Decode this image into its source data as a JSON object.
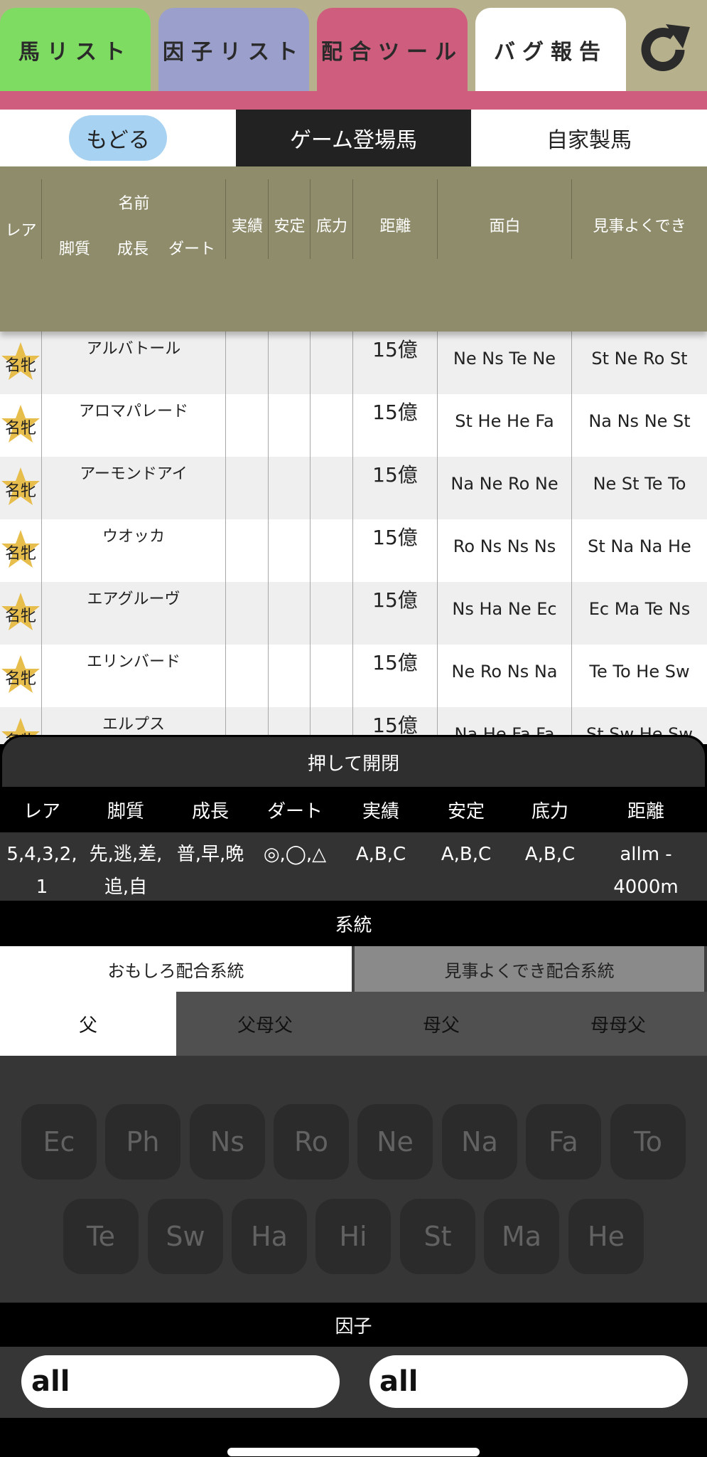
{
  "top_tabs": [
    {
      "label": "馬リスト"
    },
    {
      "label": "因子リスト"
    },
    {
      "label": "配合ツール"
    },
    {
      "label": "バグ報告"
    }
  ],
  "sub_tabs": {
    "back": "もどる",
    "game": "ゲーム登場馬",
    "home": "自家製馬"
  },
  "header": {
    "rarity": "レア",
    "name": "名前",
    "style": "脚質",
    "growth": "成長",
    "dirt": "ダート",
    "record": "実績",
    "stable": "安定",
    "power": "底力",
    "distance": "距離",
    "fun": "面白",
    "good": "見事よくでき"
  },
  "rows": [
    {
      "rank": "名牝",
      "name": "アルバトール",
      "distance": "15億",
      "fun": "Ne Ns Te Ne",
      "good": "St Ne Ro St"
    },
    {
      "rank": "名牝",
      "name": "アロマパレード",
      "distance": "15億",
      "fun": "St He He Fa",
      "good": "Na Ns Ne St"
    },
    {
      "rank": "名牝",
      "name": "アーモンドアイ",
      "distance": "15億",
      "fun": "Na Ne Ro Ne",
      "good": "Ne St Te To"
    },
    {
      "rank": "名牝",
      "name": "ウオッカ",
      "distance": "15億",
      "fun": "Ro Ns Ns Ns",
      "good": "St Na Na He"
    },
    {
      "rank": "名牝",
      "name": "エアグルーヴ",
      "distance": "15億",
      "fun": "Ns Ha Ne Ec",
      "good": "Ec Ma Te Ns"
    },
    {
      "rank": "名牝",
      "name": "エリンバード",
      "distance": "15億",
      "fun": "Ne Ro Ns Na",
      "good": "Te To He Sw"
    },
    {
      "rank": "名牝",
      "name": "エルプス",
      "distance": "15億",
      "fun": "Na He Fa Fa",
      "good": "St Sw He Sw"
    }
  ],
  "panel": {
    "toggle": "押して開閉",
    "filter_headers": [
      "レア",
      "脚質",
      "成長",
      "ダート",
      "実績",
      "安定",
      "底力",
      "距離"
    ],
    "filter_values": [
      "5,4,3,2,\n1",
      "先,逃,差,\n追,自",
      "普,早,晩",
      "◎,◯,△",
      "A,B,C",
      "A,B,C",
      "A,B,C",
      "allm -\n4000m"
    ],
    "keito_label": "系統",
    "segment1": [
      "おもしろ配合系統",
      "見事よくでき配合系統"
    ],
    "segment2": [
      "父",
      "父母父",
      "母父",
      "母母父"
    ],
    "chips_row1": [
      "Ec",
      "Ph",
      "Ns",
      "Ro",
      "Ne",
      "Na",
      "Fa",
      "To"
    ],
    "chips_row2": [
      "Te",
      "Sw",
      "Ha",
      "Hi",
      "St",
      "Ma",
      "He"
    ],
    "inshi_label": "因子",
    "input1": "all",
    "input2": "all"
  }
}
